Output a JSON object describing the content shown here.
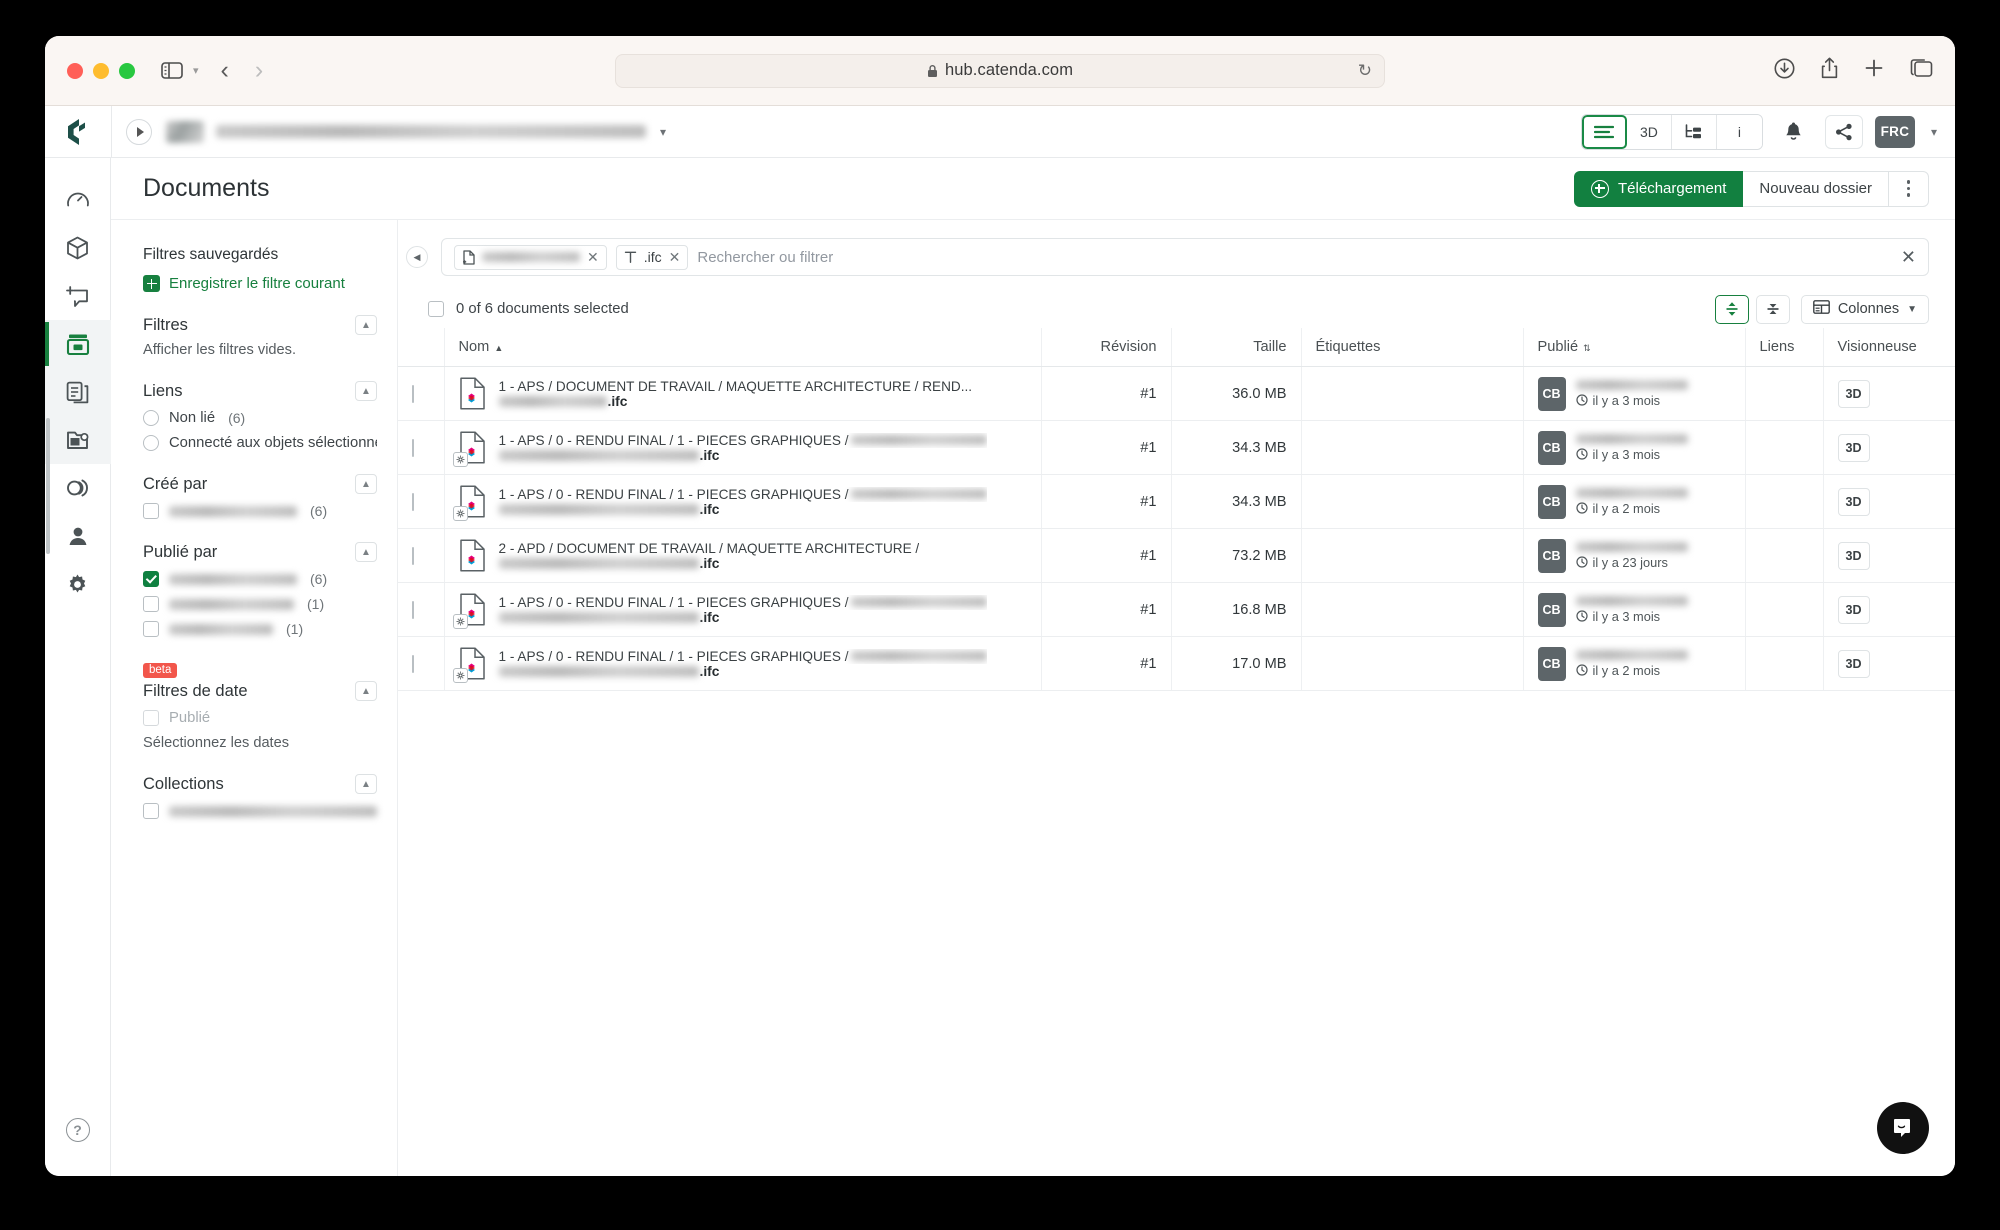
{
  "browser": {
    "url": "hub.catenda.com",
    "lock_icon": "lock-icon",
    "reload_icon": "reload-icon",
    "back_icon": "back-arrow-icon",
    "forward_icon": "forward-arrow-icon",
    "sidebar_icon": "sidebar-toggle-icon",
    "shield_icon": "shield-icon",
    "flask_icon": "flask-icon",
    "download_icon": "download-icon",
    "share_icon": "share-icon",
    "newtab_icon": "new-tab-icon",
    "tabs_icon": "tab-overview-icon"
  },
  "app_header": {
    "logo": "catenda-logo",
    "play_button": "project-expand-icon",
    "project_thumb": "project-thumbnail",
    "project_name": "",
    "project_chevron": "chevron-down-icon",
    "view_buttons": [
      {
        "name": "list-view",
        "label": "≡",
        "active": true
      },
      {
        "name": "3d-view",
        "label": "3D",
        "active": false
      },
      {
        "name": "tree-view",
        "label": "tree",
        "active": false
      },
      {
        "name": "info-view",
        "label": "i",
        "active": false
      }
    ],
    "notifications_icon": "bell-icon",
    "share_icon": "share-nodes-icon",
    "user_initials": "FRC",
    "user_chevron": "chevron-down-icon"
  },
  "rail": {
    "items": [
      {
        "name": "sidebar-item-dashboard",
        "icon": "gauge-icon",
        "active": false
      },
      {
        "name": "sidebar-item-models",
        "icon": "cube-icon",
        "active": false
      },
      {
        "name": "sidebar-item-issues",
        "icon": "comment-plus-icon",
        "active": false
      },
      {
        "name": "sidebar-item-documents",
        "icon": "archive-box-icon",
        "active": true
      },
      {
        "name": "sidebar-item-sheets",
        "icon": "pages-icon",
        "active": false
      },
      {
        "name": "sidebar-item-templates",
        "icon": "folder-gear-icon",
        "active": false
      },
      {
        "name": "sidebar-item-links",
        "icon": "links-icon",
        "active": false
      },
      {
        "name": "sidebar-item-members",
        "icon": "person-icon",
        "active": false
      },
      {
        "name": "sidebar-item-settings",
        "icon": "gear-icon",
        "active": false
      }
    ],
    "help_label": "?"
  },
  "page": {
    "title": "Documents",
    "upload_label": "Téléchargement",
    "new_folder_label": "Nouveau dossier",
    "kebab_icon": "more-options-icon"
  },
  "filters": {
    "saved_title": "Filtres sauvegardés",
    "save_current_label": "Enregistrer le filtre courant",
    "sections": [
      {
        "name": "filtres",
        "title": "Filtres",
        "note": "Afficher les filtres vides.",
        "collapse_icon": "chevron-up-icon"
      },
      {
        "name": "liens",
        "title": "Liens",
        "collapse_icon": "chevron-up-icon",
        "options": [
          {
            "label": "Non lié",
            "count": "(6)",
            "type": "radio",
            "checked": false
          },
          {
            "label": "Connecté aux objets sélectionné",
            "count": "",
            "type": "radio",
            "checked": false
          }
        ]
      },
      {
        "name": "cree-par",
        "title": "Créé par",
        "collapse_icon": "chevron-up-icon",
        "options": [
          {
            "label": "",
            "count": "(6)",
            "type": "checkbox",
            "checked": false,
            "redacted": true
          }
        ]
      },
      {
        "name": "publie-par",
        "title": "Publié par",
        "collapse_icon": "chevron-up-icon",
        "options": [
          {
            "label": "",
            "count": "(6)",
            "type": "checkbox",
            "checked": true,
            "redacted": true
          },
          {
            "label": "",
            "count": "(1)",
            "type": "checkbox",
            "checked": false,
            "redacted": true
          },
          {
            "label": "",
            "count": "(1)",
            "type": "checkbox",
            "checked": false,
            "redacted": true
          }
        ]
      },
      {
        "name": "filtres-de-date",
        "title": "Filtres de date",
        "badge": "beta",
        "collapse_icon": "chevron-up-icon",
        "options": [
          {
            "label": "Publié",
            "count": "",
            "type": "checkbox",
            "checked": false,
            "disabled": true
          }
        ],
        "note": "Sélectionnez les dates"
      },
      {
        "name": "collections",
        "title": "Collections",
        "collapse_icon": "chevron-up-icon",
        "options": [
          {
            "label": "",
            "count": "",
            "type": "checkbox",
            "checked": false,
            "redacted": true
          }
        ]
      }
    ]
  },
  "search": {
    "collapse_icon": "collapse-panel-icon",
    "placeholder": "Rechercher ou filtrer",
    "clear_icon": "clear-icon",
    "chips": [
      {
        "name": "chip-folder-filter",
        "icon": "document-plus-icon",
        "text": "",
        "redacted": true
      },
      {
        "name": "chip-extension-filter",
        "icon": "text-type-icon",
        "text": ".ifc",
        "redacted": false
      }
    ]
  },
  "toolbar": {
    "selection_text": "0 of 6 documents selected",
    "density_expanded_icon": "expand-rows-icon",
    "density_compact_icon": "compact-rows-icon",
    "columns_label": "Colonnes",
    "columns_icon": "columns-icon",
    "columns_chevron": "chevron-down-icon"
  },
  "table": {
    "columns": [
      {
        "name": "col-checkbox",
        "label": ""
      },
      {
        "name": "col-nom",
        "label": "Nom",
        "sort": "asc"
      },
      {
        "name": "col-revision",
        "label": "Révision"
      },
      {
        "name": "col-taille",
        "label": "Taille"
      },
      {
        "name": "col-etiquettes",
        "label": "Étiquettes"
      },
      {
        "name": "col-publie",
        "label": "Publié",
        "sort": "both"
      },
      {
        "name": "col-liens",
        "label": "Liens"
      },
      {
        "name": "col-visionneuse",
        "label": "Visionneuse"
      }
    ],
    "rows": [
      {
        "path": "1 - APS / DOCUMENT DE TRAVAIL / MAQUETTE ARCHITECTURE / REND...",
        "path_truncated": true,
        "filename_ext": ".ifc",
        "has_gear_badge": false,
        "revision": "#1",
        "size": "36.0 MB",
        "tags": "",
        "publisher_initials": "CB",
        "published_when": "il y a 3 mois",
        "links": "",
        "viewer": "3D"
      },
      {
        "path": "1 - APS / 0 - RENDU FINAL / 1 - PIECES GRAPHIQUES /",
        "path_truncated": false,
        "filename_ext": ".ifc",
        "has_gear_badge": true,
        "revision": "#1",
        "size": "34.3 MB",
        "tags": "",
        "publisher_initials": "CB",
        "published_when": "il y a 3 mois",
        "links": "",
        "viewer": "3D"
      },
      {
        "path": "1 - APS / 0 - RENDU FINAL / 1 - PIECES GRAPHIQUES /",
        "path_truncated": false,
        "filename_ext": ".ifc",
        "has_gear_badge": true,
        "revision": "#1",
        "size": "34.3 MB",
        "tags": "",
        "publisher_initials": "CB",
        "published_when": "il y a 2 mois",
        "links": "",
        "viewer": "3D"
      },
      {
        "path": "2 - APD / DOCUMENT DE TRAVAIL / MAQUETTE ARCHITECTURE /",
        "path_truncated": false,
        "filename_ext": ".ifc",
        "has_gear_badge": false,
        "revision": "#1",
        "size": "73.2 MB",
        "tags": "",
        "publisher_initials": "CB",
        "published_when": "il y a 23 jours",
        "links": "",
        "viewer": "3D"
      },
      {
        "path": "1 - APS / 0 - RENDU FINAL / 1 - PIECES GRAPHIQUES /",
        "path_truncated": false,
        "filename_ext": ".ifc",
        "has_gear_badge": true,
        "revision": "#1",
        "size": "16.8 MB",
        "tags": "",
        "publisher_initials": "CB",
        "published_when": "il y a 3 mois",
        "links": "",
        "viewer": "3D"
      },
      {
        "path": "1 - APS / 0 - RENDU FINAL / 1 - PIECES GRAPHIQUES /",
        "path_truncated": false,
        "filename_ext": ".ifc",
        "has_gear_badge": true,
        "revision": "#1",
        "size": "17.0 MB",
        "tags": "",
        "publisher_initials": "CB",
        "published_when": "il y a 2 mois",
        "links": "",
        "viewer": "3D"
      }
    ]
  },
  "chat": {
    "icon": "intercom-chat-icon"
  },
  "colors": {
    "brand_green": "#128040",
    "accent_green": "#17803f",
    "beta_red": "#f2564b",
    "avatar_gray": "#5d6569"
  }
}
